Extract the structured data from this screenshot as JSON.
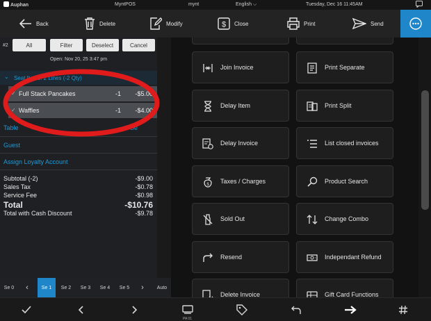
{
  "status": {
    "brand": "Auphan",
    "app": "MyntPOS",
    "user": "mynt",
    "language": "English",
    "datetime": "Tuesday, Dec 16 11:45AM"
  },
  "toolbar": {
    "back": "Back",
    "delete": "Delete",
    "modify": "Modify",
    "close": "Close",
    "print": "Print",
    "send": "Send"
  },
  "order": {
    "number": "#2",
    "buttons": [
      "All",
      "Filter",
      "Deselect",
      "Cancel"
    ],
    "opened": "Open: Nov 20, 25 3:47 pm",
    "seats_header": "Seat Items: 2 Lines (-2 Qty)",
    "items": [
      {
        "name": "Full Stack Pancakes",
        "qty": "-1",
        "price": "-$5.00"
      },
      {
        "name": "Waffles",
        "qty": "-1",
        "price": "-$4.00"
      }
    ],
    "table_label": "Table",
    "table_value": "Se",
    "guest": "Guest",
    "loyalty": "Assign Loyalty Account",
    "totals": {
      "subtotal_label": "Subtotal (-2)",
      "subtotal": "-$9.00",
      "tax_label": "Sales Tax",
      "tax": "-$0.78",
      "fee_label": "Service Fee",
      "fee": "-$0.98",
      "total_label": "Total",
      "total": "-$10.76",
      "cash_label": "Total with Cash Discount",
      "cash": "-$9.78"
    }
  },
  "seats": {
    "items": [
      "Se 0",
      "Se 1",
      "Se 2",
      "Se 3",
      "Se 4",
      "Se 5"
    ],
    "auto": "Auto",
    "prev": "‹",
    "next": "›"
  },
  "bottom": {
    "pa_label": "PA 01"
  },
  "functions": [
    "Join Invoice",
    "Print Separate",
    "Delay Item",
    "Print Split",
    "Delay Invoice",
    "List closed invoices",
    "Taxes / Charges",
    "Product Search",
    "Sold Out",
    "Change Combo",
    "Resend",
    "Independant Refund",
    "Delete Invoice",
    "Gift Card Functions"
  ],
  "colors": {
    "accent": "#1e86c9",
    "link": "#1e9ad6",
    "annotation": "#e01b1b"
  }
}
